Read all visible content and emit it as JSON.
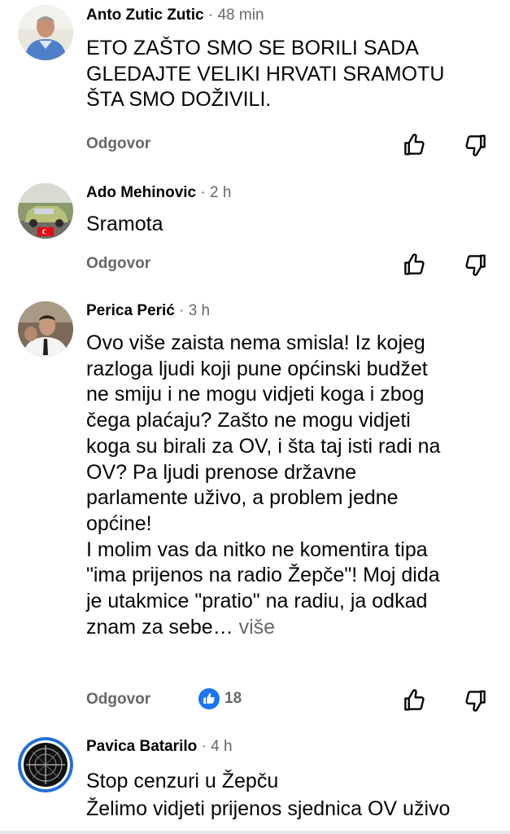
{
  "comments": [
    {
      "author": "Anto Zutic Zutic",
      "time": "48 min",
      "lines": [
        "ETO ZAŠTO SMO SE BORILI SADA",
        "GLEDAJTE VELIKI HRVATI SRAMOTU",
        "ŠTA SMO DOŽIVILI."
      ],
      "reply_label": "Odgovor"
    },
    {
      "author": "Ado Mehinovic",
      "time": "2 h",
      "lines": [
        "Sramota"
      ],
      "reply_label": "Odgovor"
    },
    {
      "author": "Perica Perić",
      "time": "3 h",
      "lines": [
        "Ovo više zaista nema smisla! Iz kojeg",
        "razloga ljudi koji pune općinski budžet",
        "ne smiju i ne mogu vidjeti koga i zbog",
        "čega plaćaju? Zašto ne mogu vidjeti",
        "koga su birali za OV, i šta taj isti radi na",
        "OV? Pa ljudi prenose državne",
        "parlamente uživo, a problem jedne",
        "općine!",
        "I molim vas da nitko ne komentira tipa",
        "\"ima prijenos na radio Žepče\"! Moj dida",
        "je utakmice \"pratio\" na radiu, ja odkad"
      ],
      "last_line": "znam za sebe…",
      "more_label": "više",
      "reply_label": "Odgovor",
      "reaction_count": "18"
    },
    {
      "author": "Pavica Batarilo",
      "time": "4 h",
      "lines": [
        "Stop cenzuri u Žepču",
        "Želimo vidjeti prijenos sjednica OV uživo"
      ]
    }
  ],
  "separator": "·",
  "icons": {
    "like": "thumbs-up-icon",
    "dislike": "thumbs-down-icon",
    "reaction": "like-reaction-icon"
  },
  "colors": {
    "text": "#050505",
    "secondary": "#65676b",
    "reaction_blue": "#1877f2"
  }
}
